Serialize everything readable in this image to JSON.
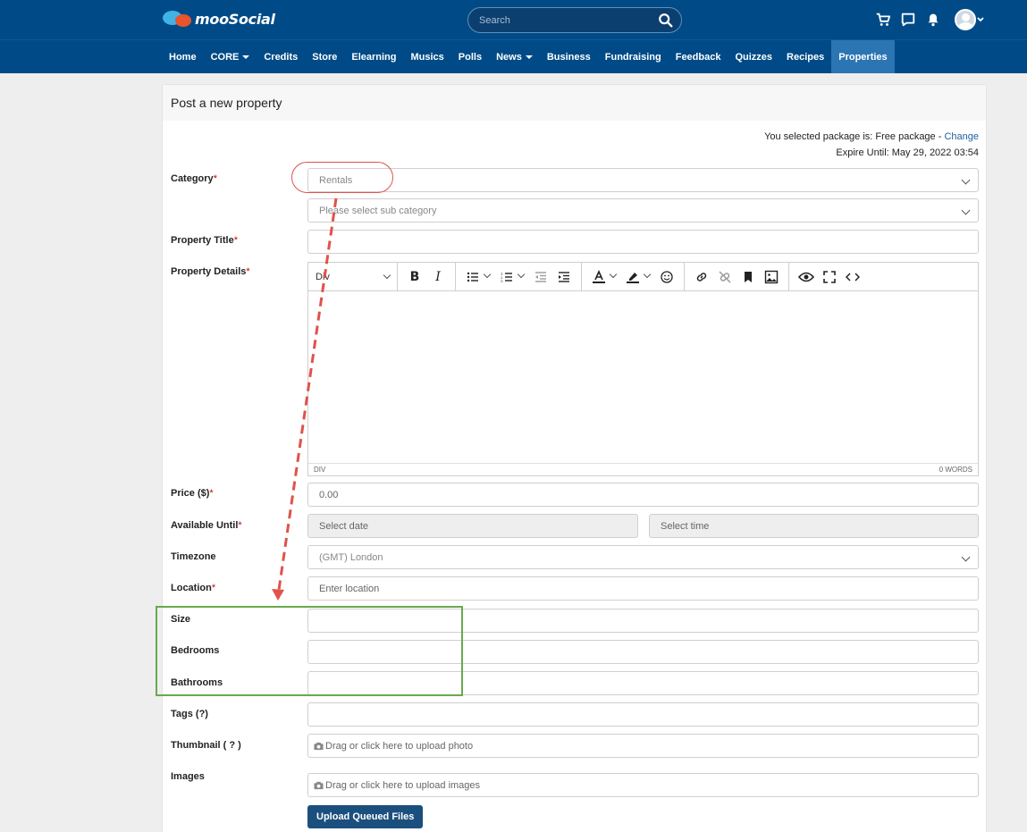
{
  "header": {
    "logo_text": "mooSocial",
    "search_placeholder": "Search"
  },
  "nav": {
    "items": [
      {
        "label": "Home"
      },
      {
        "label": "CORE",
        "dropdown": true
      },
      {
        "label": "Credits"
      },
      {
        "label": "Store"
      },
      {
        "label": "Elearning"
      },
      {
        "label": "Musics"
      },
      {
        "label": "Polls"
      },
      {
        "label": "News",
        "dropdown": true
      },
      {
        "label": "Business"
      },
      {
        "label": "Fundraising"
      },
      {
        "label": "Feedback"
      },
      {
        "label": "Quizzes"
      },
      {
        "label": "Recipes"
      },
      {
        "label": "Properties",
        "active": true
      }
    ]
  },
  "form": {
    "title": "Post a new property",
    "package_text": "You selected package is: Free package - ",
    "package_change": "Change",
    "expire_text": "Expire Until: May 29, 2022 03:54",
    "category_label": "Category",
    "category_value": "Rentals",
    "subcategory_placeholder": "Please select sub category",
    "title_label": "Property Title",
    "details_label": "Property Details",
    "editor_block": "Div",
    "editor_path": "DIV",
    "editor_words": "0 WORDS",
    "price_label": "Price ($)",
    "price_placeholder": "0.00",
    "available_label": "Available Until",
    "date_placeholder": "Select date",
    "time_placeholder": "Select time",
    "timezone_label": "Timezone",
    "timezone_value": "(GMT) London",
    "location_label": "Location",
    "location_placeholder": "Enter location",
    "size_label": "Size",
    "bedrooms_label": "Bedrooms",
    "bathrooms_label": "Bathrooms",
    "tags_label": "Tags  (?)",
    "thumbnail_label": "Thumbnail ( ? )",
    "thumbnail_hint": "Drag or click here to upload photo",
    "images_label": "Images",
    "images_hint": "Drag or click here to upload images",
    "upload_button": "Upload Queued Files",
    "required_mark": "*"
  },
  "colors": {
    "brand": "#004b87",
    "active_nav": "#2c75b3",
    "annotation_red": "#e0524a",
    "annotation_green": "#6aa84f"
  }
}
